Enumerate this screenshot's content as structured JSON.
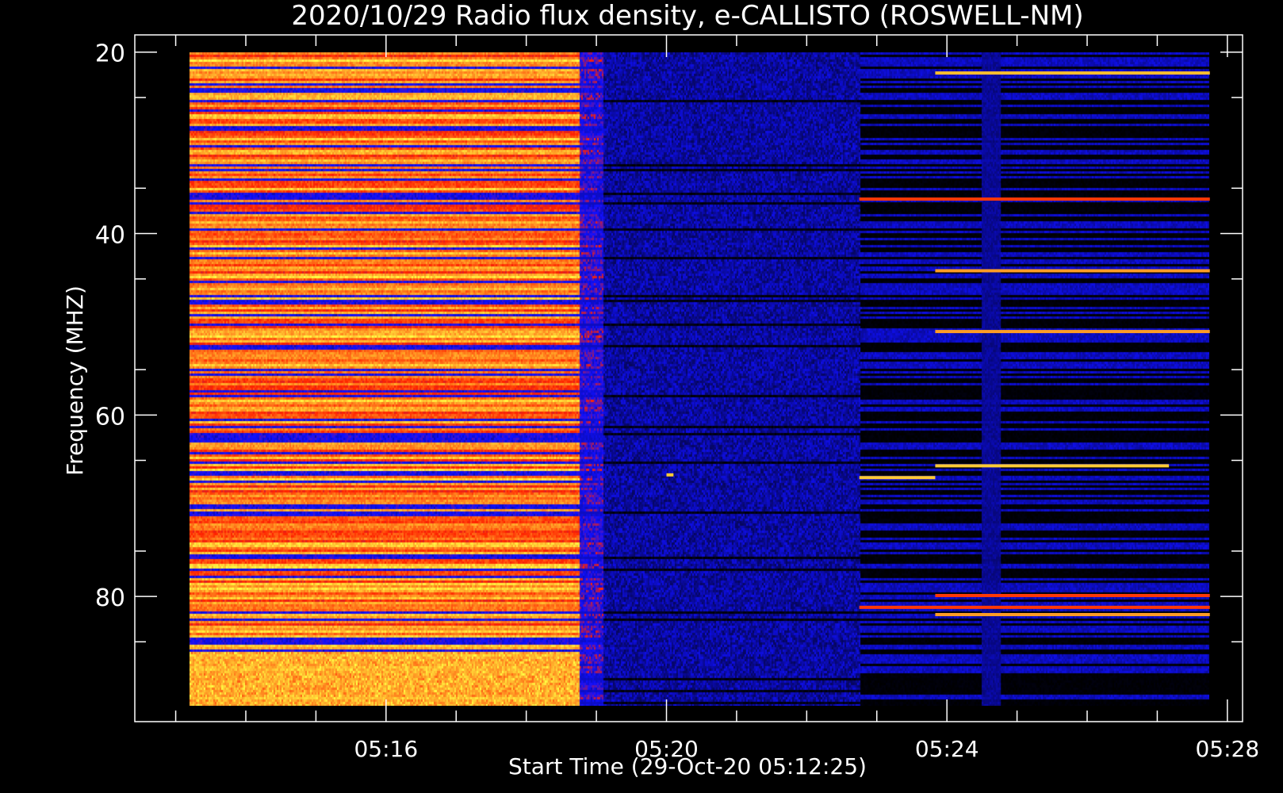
{
  "chart_data": {
    "type": "heatmap",
    "title": "2020/10/29  Radio flux density, e-CALLISTO (ROSWELL-NM)",
    "xlabel": "Start Time (29-Oct-20 05:12:25)",
    "ylabel": "Frequency (MHZ)",
    "x_ticks": [
      "05:16",
      "05:20",
      "05:24",
      "05:28"
    ],
    "y_ticks": [
      "20",
      "40",
      "60",
      "80"
    ],
    "xlim": [
      "05:12:25",
      "05:28:13"
    ],
    "ylim": [
      18.1,
      93.8
    ],
    "data_range": {
      "x": [
        "05:13:12",
        "05:27:45"
      ],
      "y": [
        20,
        92
      ]
    },
    "y_axis_direction": "increasing-downward",
    "colormap": [
      "#000000",
      "#1010ff",
      "#ff2200",
      "#ffff44"
    ],
    "segments": [
      {
        "start": "05:13:12",
        "end": "05:18:45",
        "intensity_low": 0.55,
        "intensity_high": 0.95,
        "level": "high",
        "note": "bright red/yellow bands, strongest at 86-92 MHz"
      },
      {
        "start": "05:18:45",
        "end": "05:19:05",
        "intensity_low": 0.25,
        "intensity_high": 0.7,
        "level": "transition"
      },
      {
        "start": "05:19:05",
        "end": "05:20:05",
        "intensity_low": 0.12,
        "intensity_high": 0.3,
        "level": "low",
        "note": "blue"
      },
      {
        "start": "05:20:05",
        "end": "05:22:45",
        "intensity_low": 0.12,
        "intensity_high": 0.3,
        "level": "low",
        "note": "blue"
      },
      {
        "start": "05:22:45",
        "end": "05:23:50",
        "intensity_low": 0.0,
        "intensity_high": 0.35,
        "level": "low",
        "note": "mostly black with blue lines"
      },
      {
        "start": "05:23:50",
        "end": "05:27:45",
        "intensity_low": 0.0,
        "intensity_high": 0.3,
        "level": "low",
        "note": "black with blue lines and bright narrow bands"
      }
    ],
    "bright_lines": [
      {
        "freq": 22.3,
        "start": "05:23:50",
        "end": "05:27:45",
        "intensity": 0.9
      },
      {
        "freq": 36.2,
        "start": "05:22:45",
        "end": "05:27:45",
        "intensity": 0.7
      },
      {
        "freq": 44.1,
        "start": "05:23:50",
        "end": "05:27:45",
        "intensity": 0.85
      },
      {
        "freq": 50.8,
        "start": "05:23:50",
        "end": "05:27:45",
        "intensity": 0.85
      },
      {
        "freq": 65.6,
        "start": "05:23:50",
        "end": "05:27:10",
        "intensity": 0.92
      },
      {
        "freq": 66.9,
        "start": "05:22:45",
        "end": "05:23:50",
        "intensity": 0.92
      },
      {
        "freq": 66.6,
        "start": "05:20:00",
        "end": "05:20:06",
        "intensity": 0.92
      },
      {
        "freq": 81.2,
        "start": "05:22:45",
        "end": "05:27:45",
        "intensity": 0.7
      },
      {
        "freq": 82.0,
        "start": "05:23:50",
        "end": "05:27:45",
        "intensity": 0.85
      },
      {
        "freq": 79.9,
        "start": "05:23:50",
        "end": "05:27:45",
        "intensity": 0.7
      }
    ],
    "vertical_band": {
      "start": "05:24:30",
      "end": "05:24:45",
      "intensity": 0.2,
      "note": "blue stripe"
    }
  }
}
